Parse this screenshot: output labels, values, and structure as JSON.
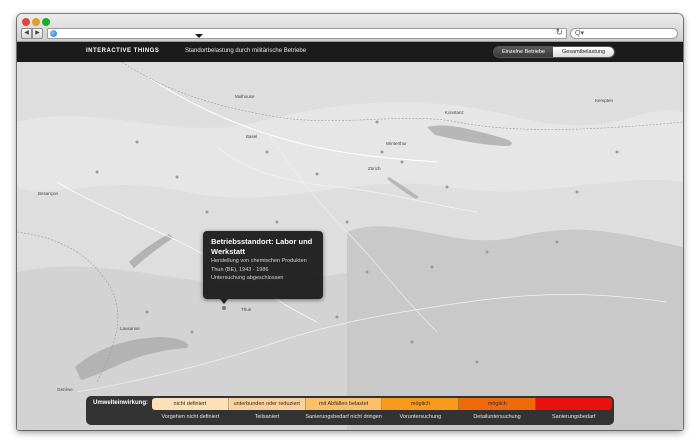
{
  "browser": {
    "back_glyph": "◀",
    "forward_glyph": "▶",
    "reload_glyph": "↻",
    "search_glyph": "Q▾"
  },
  "appbar": {
    "brand": "INTERACTIVE THINGS",
    "subtitle": "Standortbelastung durch militärische Betriebe",
    "toggle": [
      "Einzelne Betriebe",
      "Gesamtbelastung"
    ]
  },
  "map": {
    "labels": [
      "Mulhouse",
      "Basel",
      "Konstanz",
      "Kempten",
      "Winterthur",
      "Zürich",
      "Besançon",
      "Thun",
      "Lausanne",
      "Genève"
    ]
  },
  "tooltip": {
    "title": "Betriebsstandort: Labor und Werkstatt",
    "lines": [
      "Herstellung von chemischen Produkten",
      "Thun (BE), 1943 - 1986",
      "Untersuchung abgeschlossen"
    ]
  },
  "legend": {
    "title": "Umwelteinwirkung:",
    "categories": [
      {
        "label": "nicht definiert",
        "color": "#fde0b8"
      },
      {
        "label": "unterbunden oder reduziert",
        "color": "#fcd29a"
      },
      {
        "label": "mit Abfällen belastet",
        "color": "#fcc06a"
      },
      {
        "label": "möglich",
        "color": "#f99a1c"
      },
      {
        "label": "möglich",
        "color": "#f06a0c"
      },
      {
        "label": "",
        "color": "#e8120c"
      }
    ],
    "statuses": [
      "Vorgehen nicht definiert",
      "Teilsaniert",
      "Sanierungsbedarf nicht dringend",
      "Voruntersuchung",
      "Detailuntersuchung",
      "Sanierungsbedarf"
    ]
  }
}
